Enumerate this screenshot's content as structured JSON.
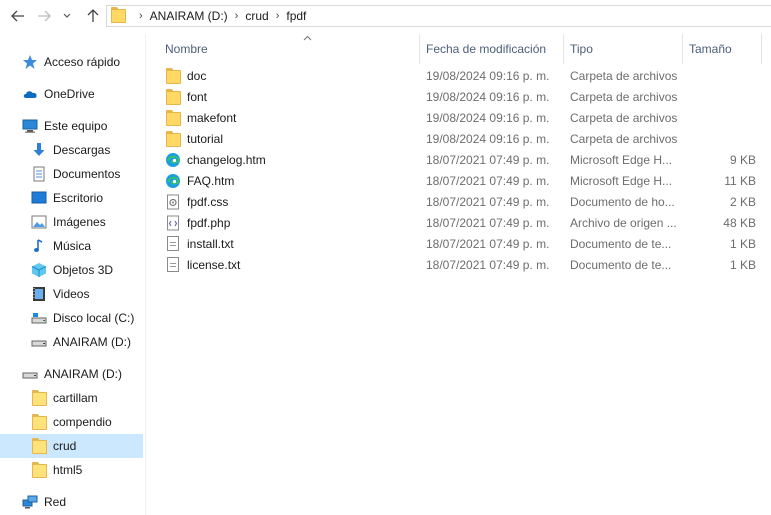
{
  "address": {
    "crumbs": [
      "ANAIRAM (D:)",
      "crud",
      "fpdf"
    ]
  },
  "sidebar": {
    "items": [
      {
        "label": "Acceso rápido",
        "icon": "star-icon"
      },
      {
        "label": "OneDrive",
        "icon": "cloud-icon"
      },
      {
        "label": "Este equipo",
        "icon": "computer-icon"
      },
      {
        "label": "Descargas",
        "icon": "download-icon"
      },
      {
        "label": "Documentos",
        "icon": "documents-icon"
      },
      {
        "label": "Escritorio",
        "icon": "desktop-icon"
      },
      {
        "label": "Imágenes",
        "icon": "pictures-icon"
      },
      {
        "label": "Música",
        "icon": "music-icon"
      },
      {
        "label": "Objetos 3D",
        "icon": "objects-3d-icon"
      },
      {
        "label": "Videos",
        "icon": "videos-icon"
      },
      {
        "label": "Disco local (C:)",
        "icon": "local-disk-icon"
      },
      {
        "label": "ANAIRAM (D:)",
        "icon": "drive-icon"
      },
      {
        "label": "ANAIRAM (D:)",
        "icon": "drive-icon"
      },
      {
        "label": "cartillam",
        "icon": "folder-icon"
      },
      {
        "label": "compendio",
        "icon": "folder-icon"
      },
      {
        "label": "crud",
        "icon": "folder-icon",
        "selected": true
      },
      {
        "label": "html5",
        "icon": "folder-icon"
      },
      {
        "label": "Red",
        "icon": "network-icon"
      }
    ]
  },
  "columns": {
    "name": "Nombre",
    "date": "Fecha de modificación",
    "type": "Tipo",
    "size": "Tamaño"
  },
  "files": [
    {
      "name": "doc",
      "date": "19/08/2024 09:16 p. m.",
      "type": "Carpeta de archivos",
      "size": "",
      "icon": "folder-icon"
    },
    {
      "name": "font",
      "date": "19/08/2024 09:16 p. m.",
      "type": "Carpeta de archivos",
      "size": "",
      "icon": "folder-icon"
    },
    {
      "name": "makefont",
      "date": "19/08/2024 09:16 p. m.",
      "type": "Carpeta de archivos",
      "size": "",
      "icon": "folder-icon"
    },
    {
      "name": "tutorial",
      "date": "19/08/2024 09:16 p. m.",
      "type": "Carpeta de archivos",
      "size": "",
      "icon": "folder-icon"
    },
    {
      "name": "changelog.htm",
      "date": "18/07/2021 07:49 p. m.",
      "type": "Microsoft Edge H...",
      "size": "9 KB",
      "icon": "edge-icon"
    },
    {
      "name": "FAQ.htm",
      "date": "18/07/2021 07:49 p. m.",
      "type": "Microsoft Edge H...",
      "size": "11 KB",
      "icon": "edge-icon"
    },
    {
      "name": "fpdf.css",
      "date": "18/07/2021 07:49 p. m.",
      "type": "Documento de ho...",
      "size": "2 KB",
      "icon": "css-file-icon"
    },
    {
      "name": "fpdf.php",
      "date": "18/07/2021 07:49 p. m.",
      "type": "Archivo de origen ...",
      "size": "48 KB",
      "icon": "php-file-icon"
    },
    {
      "name": "install.txt",
      "date": "18/07/2021 07:49 p. m.",
      "type": "Documento de te...",
      "size": "1 KB",
      "icon": "text-file-icon"
    },
    {
      "name": "license.txt",
      "date": "18/07/2021 07:49 p. m.",
      "type": "Documento de te...",
      "size": "1 KB",
      "icon": "text-file-icon"
    }
  ],
  "colors": {
    "selection": "#cce8ff",
    "header_text": "#4c607a",
    "folder": "#ffd866"
  }
}
